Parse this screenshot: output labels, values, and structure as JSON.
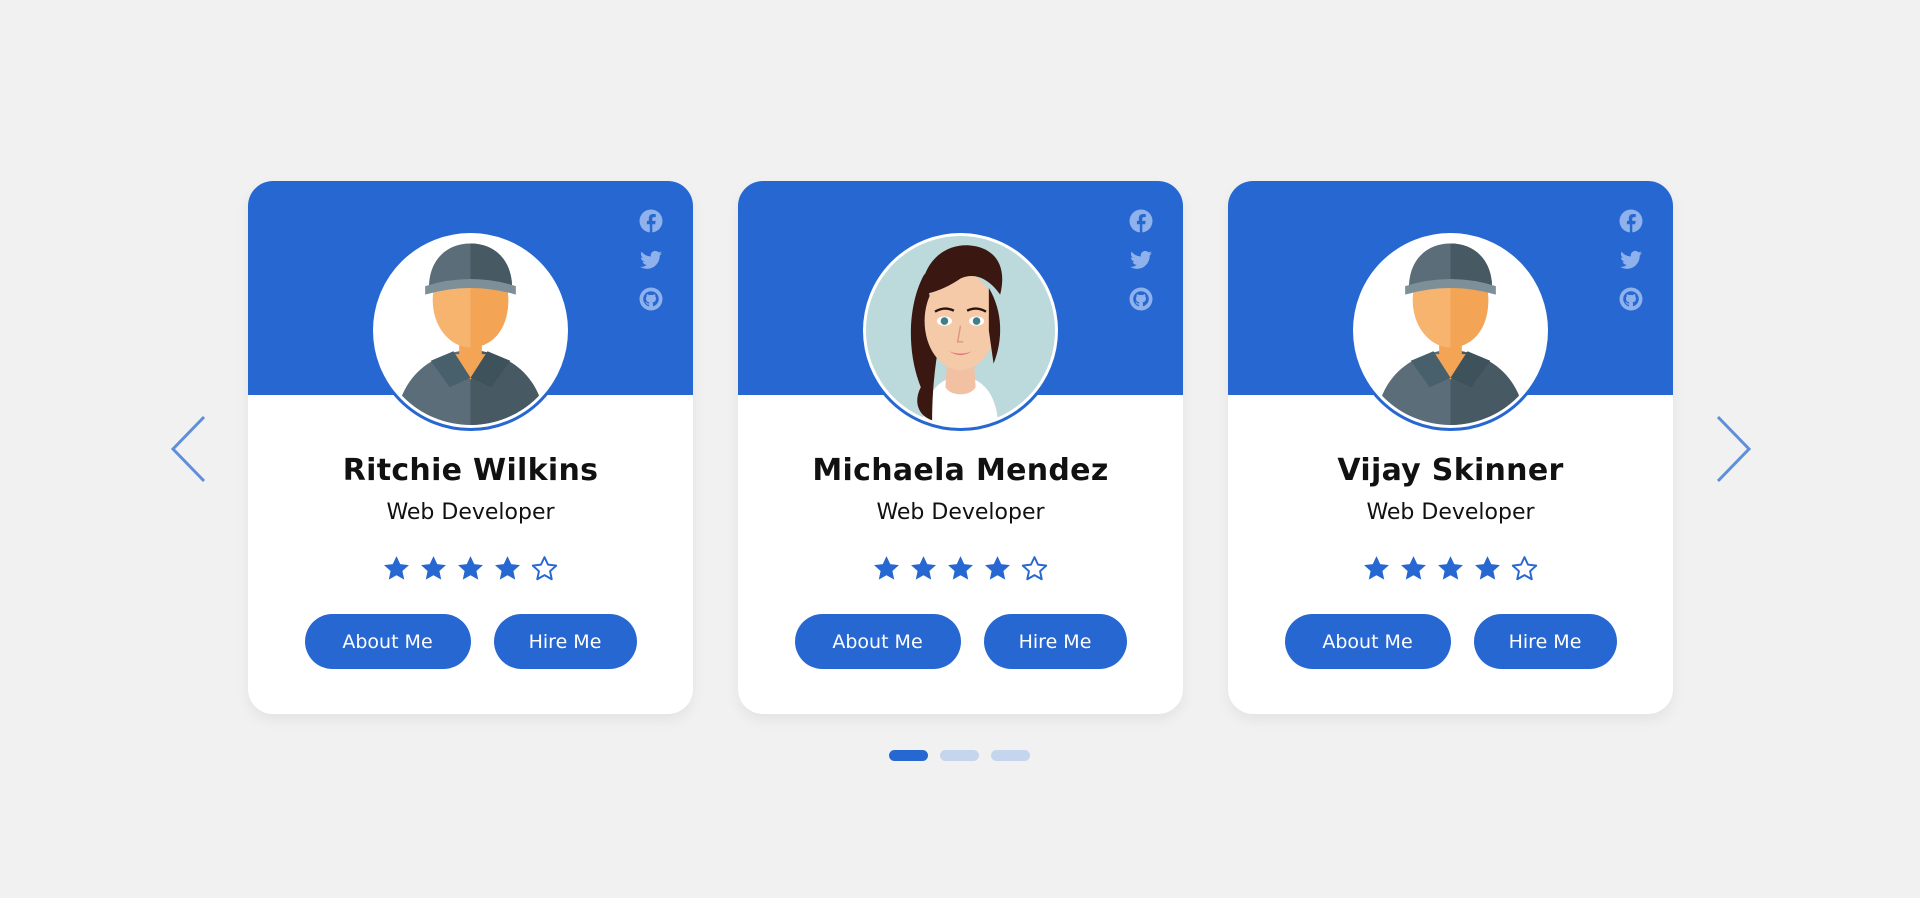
{
  "colors": {
    "primary": "#2767d1",
    "dot_inactive": "#c5d5ee",
    "background": "#f1f1f1"
  },
  "navigation": {
    "prev_icon": "chevron-left-icon",
    "next_icon": "chevron-right-icon"
  },
  "profiles": [
    {
      "name": "Ritchie Wilkins",
      "role": "Web Developer",
      "rating": 4,
      "max_rating": 5,
      "avatar": "male-avatar-cap",
      "socials": [
        "facebook-icon",
        "twitter-icon",
        "github-icon"
      ],
      "about_label": "About Me",
      "hire_label": "Hire Me"
    },
    {
      "name": "Michaela Mendez",
      "role": "Web Developer",
      "rating": 4,
      "max_rating": 5,
      "avatar": "female-avatar",
      "socials": [
        "facebook-icon",
        "twitter-icon",
        "github-icon"
      ],
      "about_label": "About Me",
      "hire_label": "Hire Me"
    },
    {
      "name": "Vijay Skinner",
      "role": "Web Developer",
      "rating": 4,
      "max_rating": 5,
      "avatar": "male-avatar-cap",
      "socials": [
        "facebook-icon",
        "twitter-icon",
        "github-icon"
      ],
      "about_label": "About Me",
      "hire_label": "Hire Me"
    }
  ],
  "pagination": {
    "pages": 3,
    "active": 0
  }
}
